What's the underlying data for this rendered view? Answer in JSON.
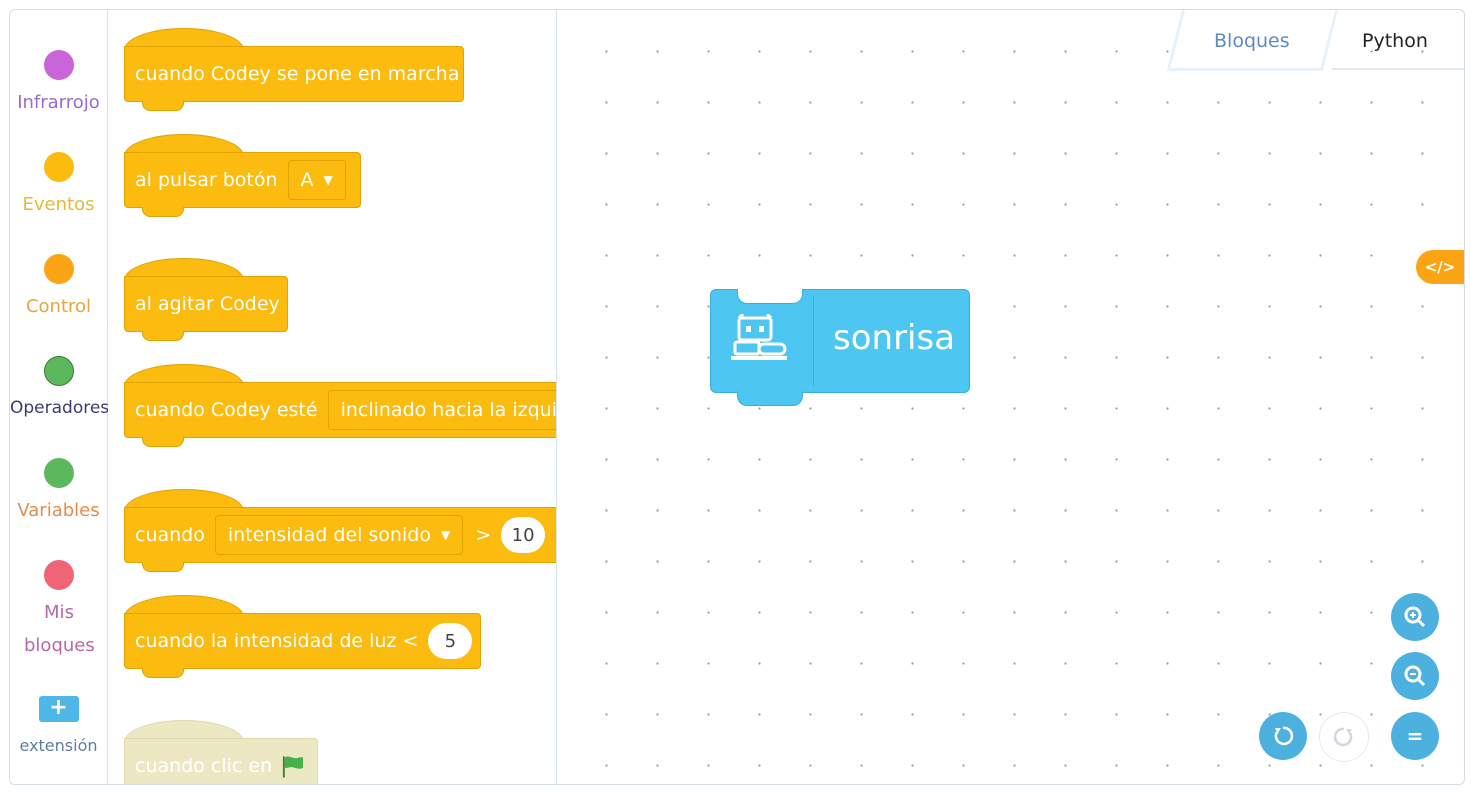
{
  "categories": [
    {
      "label": "Infrarrojo",
      "color": "#c964d9",
      "text_color": "#9a6bc9"
    },
    {
      "label": "Eventos",
      "color": "#fbbb0f",
      "text_color": "#e6b73a"
    },
    {
      "label": "Control",
      "color": "#fba514",
      "text_color": "#e9a53b"
    },
    {
      "label": "Operadores",
      "color": "#5cb85c",
      "text_color": "#3a3a78"
    },
    {
      "label": "Variables",
      "color": "#fb8a3c",
      "text_color": "#e08e4e"
    },
    {
      "label": "Mis bloques",
      "color": "#f06478",
      "text_color": "#b46aa8"
    }
  ],
  "extension": {
    "button_symbol": "+",
    "label": "extensión"
  },
  "palette_blocks": {
    "b1": {
      "text": "cuando Codey se pone en marcha"
    },
    "b2": {
      "text": "al pulsar botón",
      "dropdown": "A"
    },
    "b3": {
      "text": "al agitar Codey"
    },
    "b4": {
      "text": "cuando Codey esté",
      "dropdown": "inclinado hacia la izquierda"
    },
    "b5": {
      "text": "cuando",
      "dropdown": "intensidad del sonido",
      "operator": ">",
      "value": "10"
    },
    "b6": {
      "text": "cuando la intensidad de luz <",
      "value": "5"
    },
    "b7": {
      "text": "cuando clic en"
    }
  },
  "dropdown_arrow": "▼",
  "tabs": {
    "blocks": "Bloques",
    "python": "Python",
    "active": "Bloques"
  },
  "code_toggle": {
    "symbol": "</>"
  },
  "workspace_block": {
    "text": "sonrisa",
    "icon": "codey-robot-icon"
  },
  "zoom_controls": {
    "zoom_in": "+",
    "zoom_out": "−",
    "reset": "="
  }
}
